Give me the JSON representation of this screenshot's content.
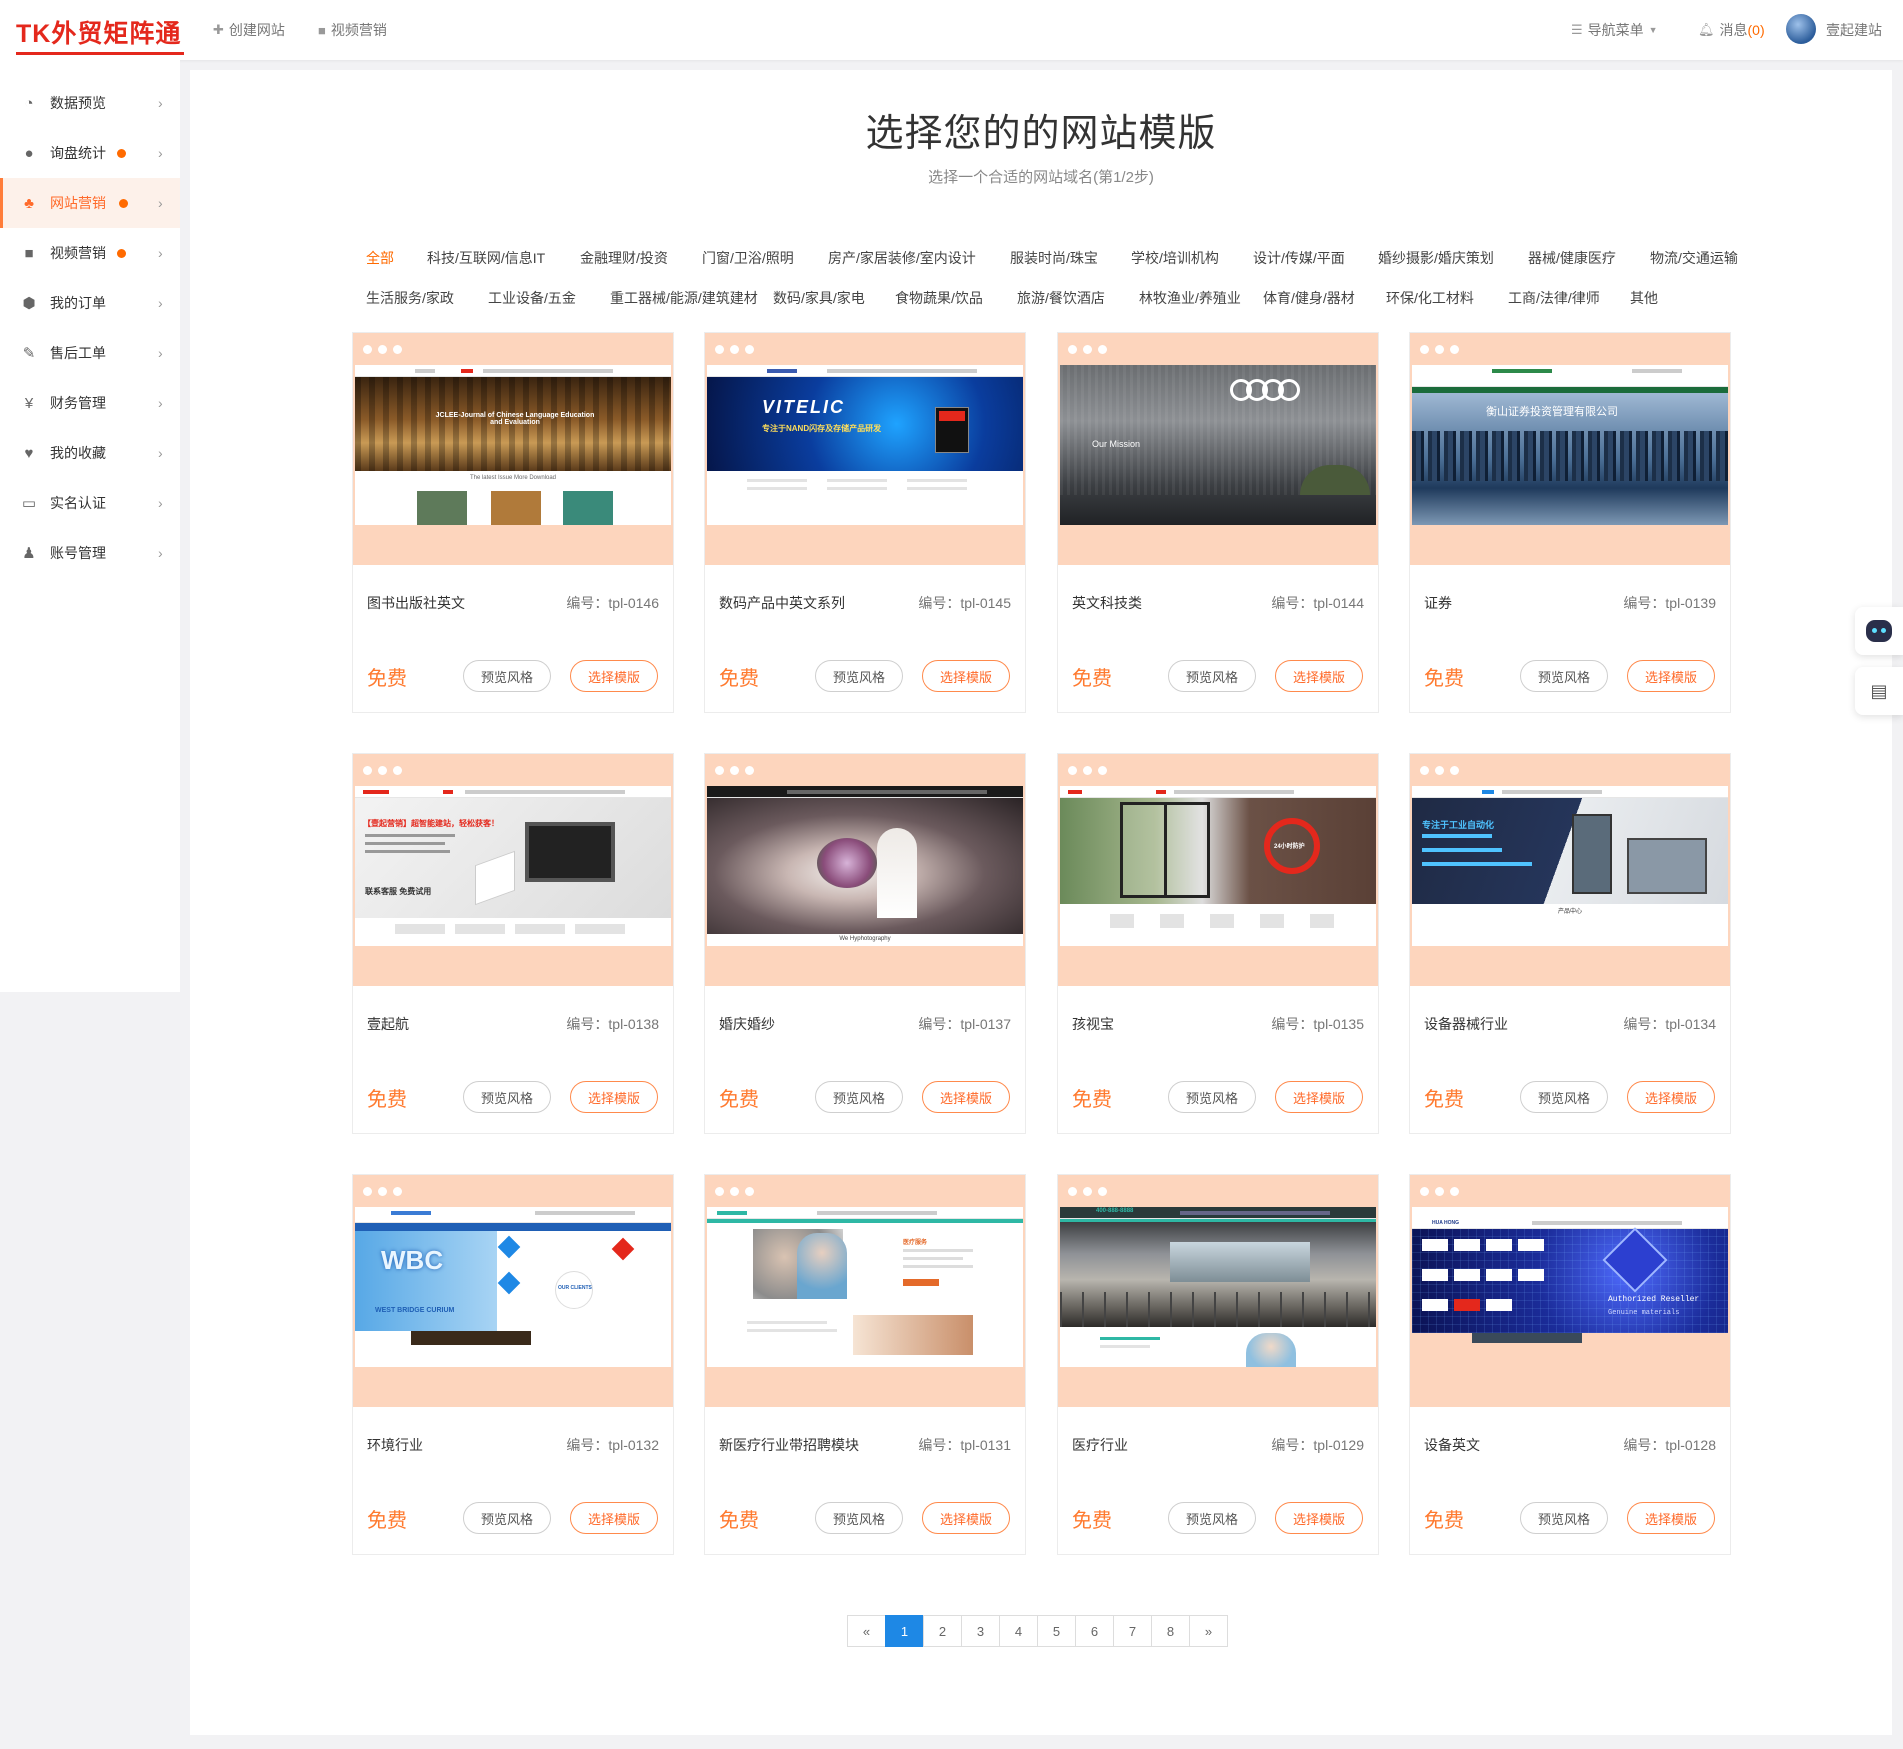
{
  "header": {
    "logo": "TK外贸矩阵通",
    "nav": [
      {
        "icon": "plus-icon",
        "label": "创建网站"
      },
      {
        "icon": "video-camera-icon",
        "label": "视频营销"
      }
    ],
    "nav_menu": "导航菜单",
    "messages_label": "消息",
    "messages_count": "(0)",
    "user": "壹起建站"
  },
  "sidebar": {
    "items": [
      {
        "label": "数据预览",
        "icon": "dashboard-icon",
        "dot": false,
        "active": false
      },
      {
        "label": "询盘统计",
        "icon": "chat-bubble-icon",
        "dot": true,
        "active": false
      },
      {
        "label": "网站营销",
        "icon": "sitemap-icon",
        "dot": true,
        "active": true
      },
      {
        "label": "视频营销",
        "icon": "video-camera-icon",
        "dot": true,
        "active": false
      },
      {
        "label": "我的订单",
        "icon": "cube-icon",
        "dot": false,
        "active": false
      },
      {
        "label": "售后工单",
        "icon": "wrench-icon",
        "dot": false,
        "active": false
      },
      {
        "label": "财务管理",
        "icon": "yen-icon",
        "dot": false,
        "active": false
      },
      {
        "label": "我的收藏",
        "icon": "heart-icon",
        "dot": false,
        "active": false
      },
      {
        "label": "实名认证",
        "icon": "id-card-icon",
        "dot": false,
        "active": false
      },
      {
        "label": "账号管理",
        "icon": "user-icon",
        "dot": false,
        "active": false
      }
    ]
  },
  "main": {
    "title": "选择您的的网站模版",
    "subtitle": "选择一个合适的网站域名(第1/2步)",
    "categories_row1": [
      "全部",
      "科技/互联网/信息IT",
      "金融理财/投资",
      "门窗/卫浴/照明",
      "房产/家居装修/室内设计",
      "服装时尚/珠宝",
      "学校/培训机构",
      "设计/传媒/平面",
      "婚纱摄影/婚庆策划",
      "器械/健康医疗",
      "物流/交通运输"
    ],
    "categories_row2": [
      "生活服务/家政",
      "工业设备/五金",
      "重工器械/能源/建筑建材",
      "数码/家具/家电",
      "食物蔬果/饮品",
      "旅游/餐饮酒店",
      "林牧渔业/养殖业",
      "体育/健身/器材",
      "环保/化工材料",
      "工商/法律/律师",
      "其他"
    ],
    "active_category": "全部",
    "code_prefix": "编号：",
    "price_label": "免费",
    "preview_label": "预览风格",
    "select_label": "选择模版",
    "templates": [
      {
        "name": "图书出版社英文",
        "code": "tpl-0146",
        "theme": "library",
        "caption": "JCLEE-Journal of Chinese Language Education and Evaluation",
        "lower_text": "The latest Issue  More Download"
      },
      {
        "name": "数码产品中英文系列",
        "code": "tpl-0145",
        "theme": "vitelic",
        "caption": "VITELIC",
        "tagline": "专注于NAND闪存及存储产品研发"
      },
      {
        "name": "英文科技类",
        "code": "tpl-0144",
        "theme": "audi",
        "caption": "Our Mission"
      },
      {
        "name": "证券",
        "code": "tpl-0139",
        "theme": "city",
        "caption": "衡山证券投资管理有限公司"
      },
      {
        "name": "壹起航",
        "code": "tpl-0138",
        "theme": "yiqihang",
        "caption": "【壹起营销】超智能建站，轻松获客！",
        "cta": "联系客服  免费试用"
      },
      {
        "name": "婚庆婚纱",
        "code": "tpl-0137",
        "theme": "wedding",
        "caption": "We Hyphotography"
      },
      {
        "name": "孩视宝",
        "code": "tpl-0135",
        "theme": "window",
        "caption": "24小时防护"
      },
      {
        "name": "设备器械行业",
        "code": "tpl-0134",
        "theme": "machine",
        "caption": "专注于工业自动化",
        "lower_text": "产品中心"
      },
      {
        "name": "环境行业",
        "code": "tpl-0132",
        "theme": "wbc",
        "caption": "WBC",
        "tagline": "WEST BRIDGE CURIUM",
        "clients": "OUR CLIENTS"
      },
      {
        "name": "新医疗行业带招聘模块",
        "code": "tpl-0131",
        "theme": "medical",
        "caption": "医疗服务"
      },
      {
        "name": "医疗行业",
        "code": "tpl-0129",
        "theme": "interior",
        "caption": "400-888-8888"
      },
      {
        "name": "设备英文",
        "code": "tpl-0128",
        "theme": "chip",
        "caption": "Authorized Reseller",
        "tagline": "Genuine materials",
        "brand": "HUA HONG"
      }
    ]
  },
  "pagination": {
    "prev": "«",
    "pages": [
      "1",
      "2",
      "3",
      "4",
      "5",
      "6",
      "7",
      "8"
    ],
    "next": "»",
    "current": "1"
  },
  "colors": {
    "accent": "#ff6a00",
    "card_top": "#fdd5bd",
    "pager_active": "#1e88e5",
    "logo": "#e4281c"
  }
}
